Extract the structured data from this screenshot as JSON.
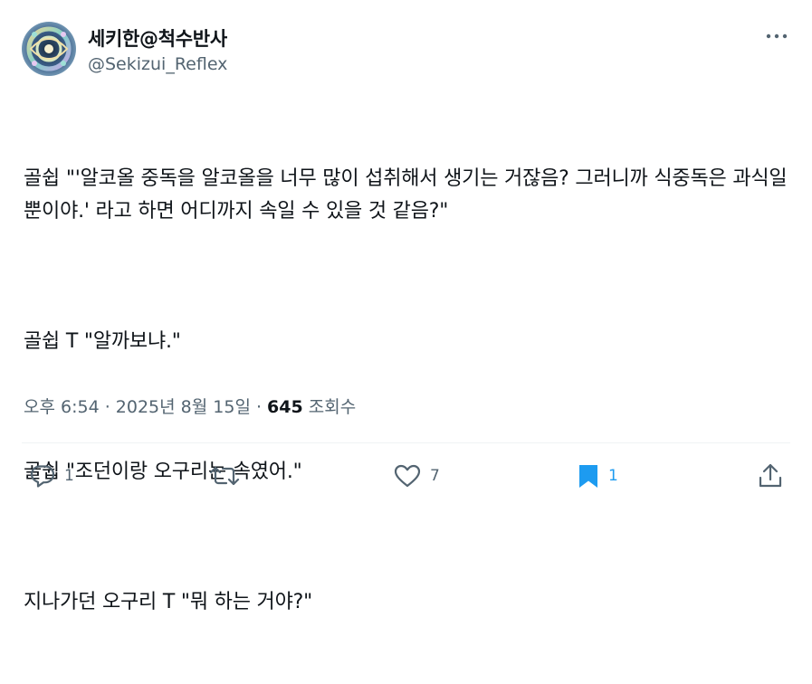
{
  "author": {
    "display_name": "세키한@척수반사",
    "handle": "@Sekizui_Reflex",
    "avatar_icon": "avatar-image"
  },
  "tweet": {
    "paragraphs": [
      "골쉽 \"'알코올 중독을 알코올을 너무 많이 섭취해서 생기는 거잖음? 그러니까 식중독은 과식일 뿐이야.' 라고 하면 어디까지 속일 수 있을 것 같음?\"",
      "골쉽 T \"알까보냐.\"",
      "골쉽 \"조던이랑 오구리는 속였어.\"",
      "지나가던 오구리 T \"뭐 하는 거야?\""
    ],
    "timestamp": "오후 6:54 · 2025년 8월 15일 · ",
    "views_count": "645",
    "views_label": " 조회수"
  },
  "actions": {
    "reply_count": "1",
    "retweet_count": "",
    "like_count": "7",
    "bookmark_count": "1"
  },
  "colors": {
    "text_primary": "#0f1419",
    "text_secondary": "#536471",
    "bookmark_active": "#1d9bf0",
    "divider": "#eff3f4"
  }
}
